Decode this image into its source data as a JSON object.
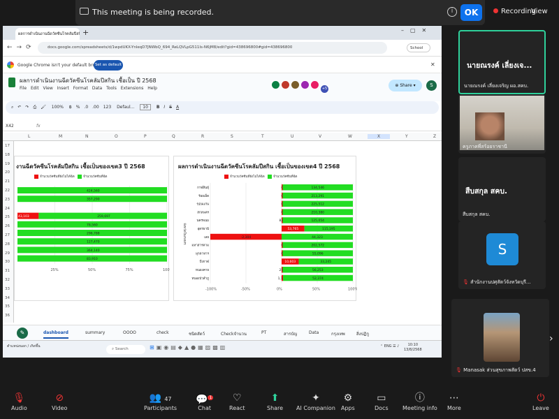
{
  "zoom": {
    "recording_banner": "This meeting is being recorded.",
    "ok_label": "OK",
    "recording_status": "Recording",
    "view_label": "View",
    "participants_count": "47",
    "chat_badge": "1",
    "toolbar": {
      "audio": "Audio",
      "video": "Video",
      "participants": "Participants",
      "chat": "Chat",
      "react": "React",
      "share": "Share",
      "ai_companion": "AI Companion",
      "apps": "Apps",
      "docs": "Docs",
      "meeting_info": "Meeting info",
      "more": "More",
      "leave": "Leave"
    },
    "gallery": [
      {
        "big": "นายณรงค์ เลี่ยงเจ...",
        "name": "นายณรงค์ เลี่ยงเจริญ ผอ.สคบ."
      },
      {
        "name": "ครูภาคพี่สร้อยราชานี"
      },
      {
        "big": "สืบสกุล สคบ.",
        "name": "สืบสกุล สคบ."
      },
      {
        "icon_letter": "S",
        "name": "สำนักงานปศุสัตว์จังหวัดบุรี..."
      },
      {
        "name": "Manasak ส่วนสุขภาพสัตว์ ปสข.4"
      }
    ]
  },
  "browser": {
    "tab_title": "ผลการดำเนินงานฉีดวัคซีนโรคลัมปีสกิน...",
    "url": "docs.google.com/spreadsheets/d/1wpdUKX-YnleqD7JNWbQ_694_ReLQVLpG511Is-N6jM8/edit?gid=438696800#gid=438696800",
    "profile": "School",
    "default_msg": "Google Chrome isn't your default browser",
    "set_default": "Set as default"
  },
  "sheets": {
    "title": "ผลการดำเนินงานฉีดวัคซีนโรคลัมปีสกิน เชื้อเป็น ปี 2568",
    "menus": [
      "File",
      "Edit",
      "View",
      "Insert",
      "Format",
      "Data",
      "Tools",
      "Extensions",
      "Help"
    ],
    "avatar_more": "+5",
    "share": "Share",
    "profile_initial": "S",
    "toolbar": {
      "zoom": "100%",
      "currency": "฿",
      "pct": "%",
      "dec1": ".0",
      "dec2": ".00",
      "num": "123",
      "font": "Defaul...",
      "size": "10"
    },
    "cell_ref": "X42",
    "fx": "fx",
    "columns": [
      "L",
      "M",
      "N",
      "O",
      "P",
      "Q",
      "R",
      "S",
      "T",
      "U",
      "V",
      "W",
      "X",
      "Y",
      "Z"
    ],
    "rows": [
      "17",
      "18",
      "19",
      "20",
      "21",
      "22",
      "23",
      "24",
      "25",
      "26",
      "27",
      "28",
      "29",
      "30",
      "31",
      "32",
      "33",
      "34",
      "35",
      "36"
    ],
    "tabs": [
      "dashboard",
      "summary",
      "OOOO",
      "check",
      "ชนิดสัตว์",
      "Checkจำนวน",
      "PT",
      "สารบัญ",
      "Data",
      "กรุงเทพ",
      "สิ่งปฏิกู"
    ]
  },
  "chart_data": [
    {
      "type": "bar",
      "orientation": "horizontal",
      "stacked": true,
      "title": "งานฉีดวัคซีนโรคลัมปีสกิน เชื้อเป็นของเขต3 ปี 2568",
      "legend": [
        "จำนวนวัคซีนที่ยังไม่ได้ฉีด",
        "จำนวนวัคซีนที่ฉีด"
      ],
      "colors": [
        "#ee1111",
        "#22dd22"
      ],
      "xticks": [
        "25%",
        "50%",
        "75%",
        "100%"
      ],
      "xlim": [
        0,
        100
      ],
      "series": [
        {
          "name": "จำนวนวัคซีนที่ยังไม่ได้ฉีด",
          "values": [
            0,
            0,
            0,
            43103,
            0,
            0,
            0,
            0,
            0
          ]
        },
        {
          "name": "จำนวนวัคซีนที่ฉีด",
          "values": [
            424560,
            357290,
            0,
            259697,
            78560,
            296788,
            127470,
            364140,
            83910
          ]
        }
      ],
      "label_text": [
        [
          "",
          "424,560"
        ],
        [
          "",
          "357,290"
        ],
        [
          "",
          ""
        ],
        [
          "43,103",
          "259,697"
        ],
        [
          "",
          "78,560"
        ],
        [
          "",
          "296,788"
        ],
        [
          "",
          "127,470"
        ],
        [
          "",
          "364,140"
        ],
        [
          "",
          "83,910"
        ]
      ],
      "pct_unfilled": [
        0,
        0,
        0,
        14.2,
        0,
        0,
        0,
        0,
        0
      ]
    },
    {
      "type": "bar",
      "orientation": "horizontal",
      "stacked": true,
      "title": "ผลการดำเนินงานฉีดวัคซีนโรคลัมปีสกิน เชื้อเป็นของเขต4 ปี 2568",
      "ylabel": "จังหวัดในเขตสร",
      "legend": [
        "จำนวนวัคซีนที่ยังไม่ได้ฉีด",
        "จำนวนวัคซีนที่ฉีด"
      ],
      "colors": [
        "#ee1111",
        "#22dd22"
      ],
      "xticks": [
        "-100%",
        "-50%",
        "0%",
        "50%",
        "100%"
      ],
      "xlim": [
        -100,
        100
      ],
      "categories": [
        "กาฬสินธุ์",
        "ร้อยเอ็ด",
        "ขอนแก่น",
        "สกลนคร",
        "นครพนม",
        "อุดรธานี",
        "เลย",
        "มหาสารคาม",
        "มุกดาหาร",
        "บึงกาฬ",
        "หนองคาย",
        "หนองบัวลำภู"
      ],
      "unfilled": [
        0,
        0,
        0,
        0,
        828,
        53765,
        -2304,
        0,
        0,
        10603,
        255,
        1119
      ],
      "filled": [
        134546,
        213291,
        225512,
        210380,
        125054,
        115195,
        44323,
        202572,
        55096,
        33245,
        56253,
        52374
      ],
      "unfilled_labels": [
        "0",
        "0",
        "0",
        "0",
        "828",
        "53,765",
        "-2,304",
        "0",
        "0",
        "10,603",
        "255",
        "1,119"
      ],
      "filled_labels": [
        "134,546",
        "213,291",
        "225,512",
        "210,380",
        "125,054",
        "115,195",
        "44,323",
        "202,572",
        "55,096",
        "33,245",
        "56,253",
        "52,374"
      ],
      "pct_unfilled": [
        0,
        0,
        0,
        0,
        1,
        32,
        -100,
        0,
        0,
        24,
        0.5,
        2
      ]
    }
  ],
  "windows": {
    "search": "Search",
    "lang": "ENG",
    "time": "10:10",
    "date": "13/8/2568",
    "weather": "ตำแหน่งนอก / เกิดขึ้น"
  }
}
